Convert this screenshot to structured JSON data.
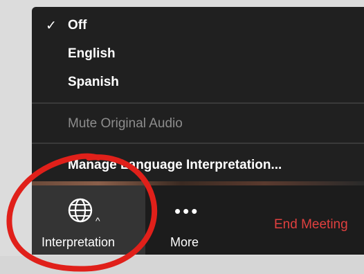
{
  "menu": {
    "items": [
      {
        "label": "Off",
        "checked": true
      },
      {
        "label": "English",
        "checked": false
      },
      {
        "label": "Spanish",
        "checked": false
      }
    ],
    "mute_label": "Mute Original Audio",
    "manage_label": "Manage Language Interpretation..."
  },
  "toolbar": {
    "interpretation_label": "Interpretation",
    "more_label": "More",
    "end_meeting_label": "End Meeting"
  },
  "icons": {
    "check": "checkmark-icon",
    "globe": "globe-icon",
    "caret": "caret-up-icon",
    "more": "ellipsis-icon"
  },
  "colors": {
    "menu_bg": "#202020",
    "toolbar_bg": "#1c1c1c",
    "interp_bg": "#343434",
    "end_meeting": "#e0403f",
    "annotation": "#e0201a"
  }
}
